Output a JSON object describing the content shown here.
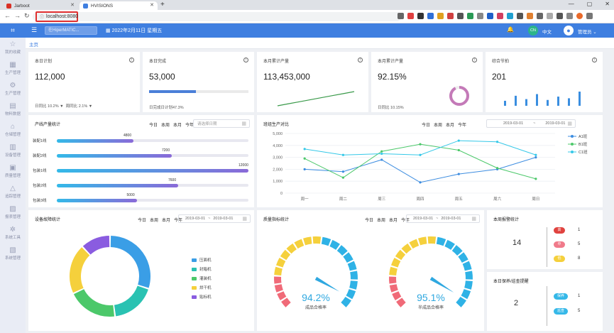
{
  "browser": {
    "tabs": [
      {
        "title": "Jarboot",
        "color": "#d93025"
      },
      {
        "title": "HVISIONS",
        "color": "#3f7fe0"
      }
    ],
    "url": "localhost:8080"
  },
  "app": {
    "logo": "logo-icon",
    "search_placeholder": "在HiperMATIC...",
    "date": "2022年2月11日 星期五",
    "lang_badge": "CN",
    "lang": "中文",
    "user": "管理员 ⌄"
  },
  "sidebar": [
    {
      "label": "我的收藏",
      "icon": "star-icon",
      "glyph": "☆"
    },
    {
      "label": "生产管理",
      "icon": "factory-icon",
      "glyph": "▦"
    },
    {
      "label": "生产管理",
      "icon": "gear-icon",
      "glyph": "⚙"
    },
    {
      "label": "物料数据",
      "icon": "box-icon",
      "glyph": "▤"
    },
    {
      "label": "仓储管理",
      "icon": "warehouse-icon",
      "glyph": "⌂"
    },
    {
      "label": "设备管理",
      "icon": "equipment-icon",
      "glyph": "▥"
    },
    {
      "label": "质量管理",
      "icon": "quality-icon",
      "glyph": "▣"
    },
    {
      "label": "追踪管理",
      "icon": "trace-icon",
      "glyph": "△"
    },
    {
      "label": "报表管理",
      "icon": "report-icon",
      "glyph": "▨"
    },
    {
      "label": "系统工具",
      "icon": "tool-icon",
      "glyph": "✲"
    },
    {
      "label": "系统管理",
      "icon": "system-icon",
      "glyph": "▧"
    }
  ],
  "page_tab": "主页",
  "kpis": [
    {
      "title": "本日计划",
      "value": "112,000",
      "sub1": "日同比 10.2% ▼",
      "sub2": "周同比 2.1% ▼"
    },
    {
      "title": "本日完成",
      "value": "53,000",
      "progress": 0.473,
      "sub": "日完成日计划47.3%"
    },
    {
      "title": "本月累计产量",
      "value": "113,453,000",
      "trend": [
        2,
        3,
        4,
        5,
        6,
        7,
        8,
        9
      ]
    },
    {
      "title": "本月累计产量",
      "value": "92.15%",
      "ratio": 0.9215,
      "sub": "日同比 10.15%"
    },
    {
      "title": "综合节拍",
      "value": "201",
      "bars": [
        6,
        12,
        8,
        14,
        7,
        11,
        9,
        17
      ]
    }
  ],
  "line_output": {
    "title": "产线产量统计",
    "filters": [
      "今日",
      "本周",
      "本月",
      "今年"
    ],
    "date_placeholder": "请选择日期",
    "chart_data": {
      "type": "bar",
      "orientation": "horizontal",
      "categories": [
        "装配1线",
        "装配2线",
        "包装1线",
        "包装2线",
        "包装3线"
      ],
      "values": [
        4800,
        7200,
        12000,
        7600,
        5000
      ],
      "max": 12000
    }
  },
  "shift_compare": {
    "title": "班组生产对比",
    "filters": [
      "今日",
      "本周",
      "本月",
      "今年"
    ],
    "date_from": "2019-03-01",
    "date_sep": "~",
    "date_to": "2019-03-01",
    "chart_data": {
      "type": "line",
      "categories": [
        "周一",
        "周二",
        "周三",
        "周四",
        "周五",
        "周六",
        "周日"
      ],
      "yticks": [
        "5,000",
        "4,000",
        "3,000",
        "2,000",
        "1,000",
        "0"
      ],
      "ylim": [
        0,
        5000
      ],
      "series": [
        {
          "name": "A1班",
          "color": "#3d8de0",
          "values": [
            2000,
            1800,
            2800,
            900,
            1600,
            2000,
            3000
          ]
        },
        {
          "name": "B1班",
          "color": "#4cc86a",
          "values": [
            2900,
            1300,
            3500,
            4100,
            3600,
            2100,
            1200
          ]
        },
        {
          "name": "C1班",
          "color": "#35c8e8",
          "values": [
            3700,
            3200,
            3300,
            3200,
            4400,
            4300,
            3200
          ]
        }
      ]
    }
  },
  "fault": {
    "title": "设备故障统计",
    "filters": [
      "今日",
      "本周",
      "本月",
      "今年"
    ],
    "date_from": "2019-03-01",
    "date_sep": "~",
    "date_to": "2019-03-01",
    "chart_data": {
      "type": "pie",
      "labels": [
        "压面机",
        "封箱机",
        "灌装机",
        "烘干机",
        "贴标机"
      ],
      "colors": [
        "#3a9ee6",
        "#2ac2b2",
        "#4cc86a",
        "#f5d03c",
        "#8a5ce0"
      ],
      "values": [
        30,
        18,
        20,
        20,
        12
      ]
    }
  },
  "quality": {
    "title": "质量指标统计",
    "filters": [
      "今日",
      "本周",
      "本月",
      "今年"
    ],
    "date_from": "2019-03-01",
    "date_sep": "~",
    "date_to": "2019-03-01",
    "chart_data": {
      "type": "gauge",
      "gauges": [
        {
          "value_text": "94.2%",
          "value": 94.2,
          "label": "成品合格率"
        },
        {
          "value_text": "95.1%",
          "value": 95.1,
          "label": "半成品合格率"
        }
      ]
    }
  },
  "alarm": {
    "title": "本周报警统计",
    "total": "14",
    "items": [
      {
        "label": "高",
        "color": "#e0433f",
        "count": "1"
      },
      {
        "label": "中",
        "color": "#f07a8a",
        "count": "5"
      },
      {
        "label": "低",
        "color": "#f5d03c",
        "count": "8"
      }
    ]
  },
  "maint": {
    "title": "本日保养/巡查提醒",
    "total": "2",
    "items": [
      {
        "label": "保养",
        "color": "#35b8e8",
        "count": "1"
      },
      {
        "label": "巡查",
        "color": "#35b8e8",
        "count": "5"
      }
    ]
  }
}
